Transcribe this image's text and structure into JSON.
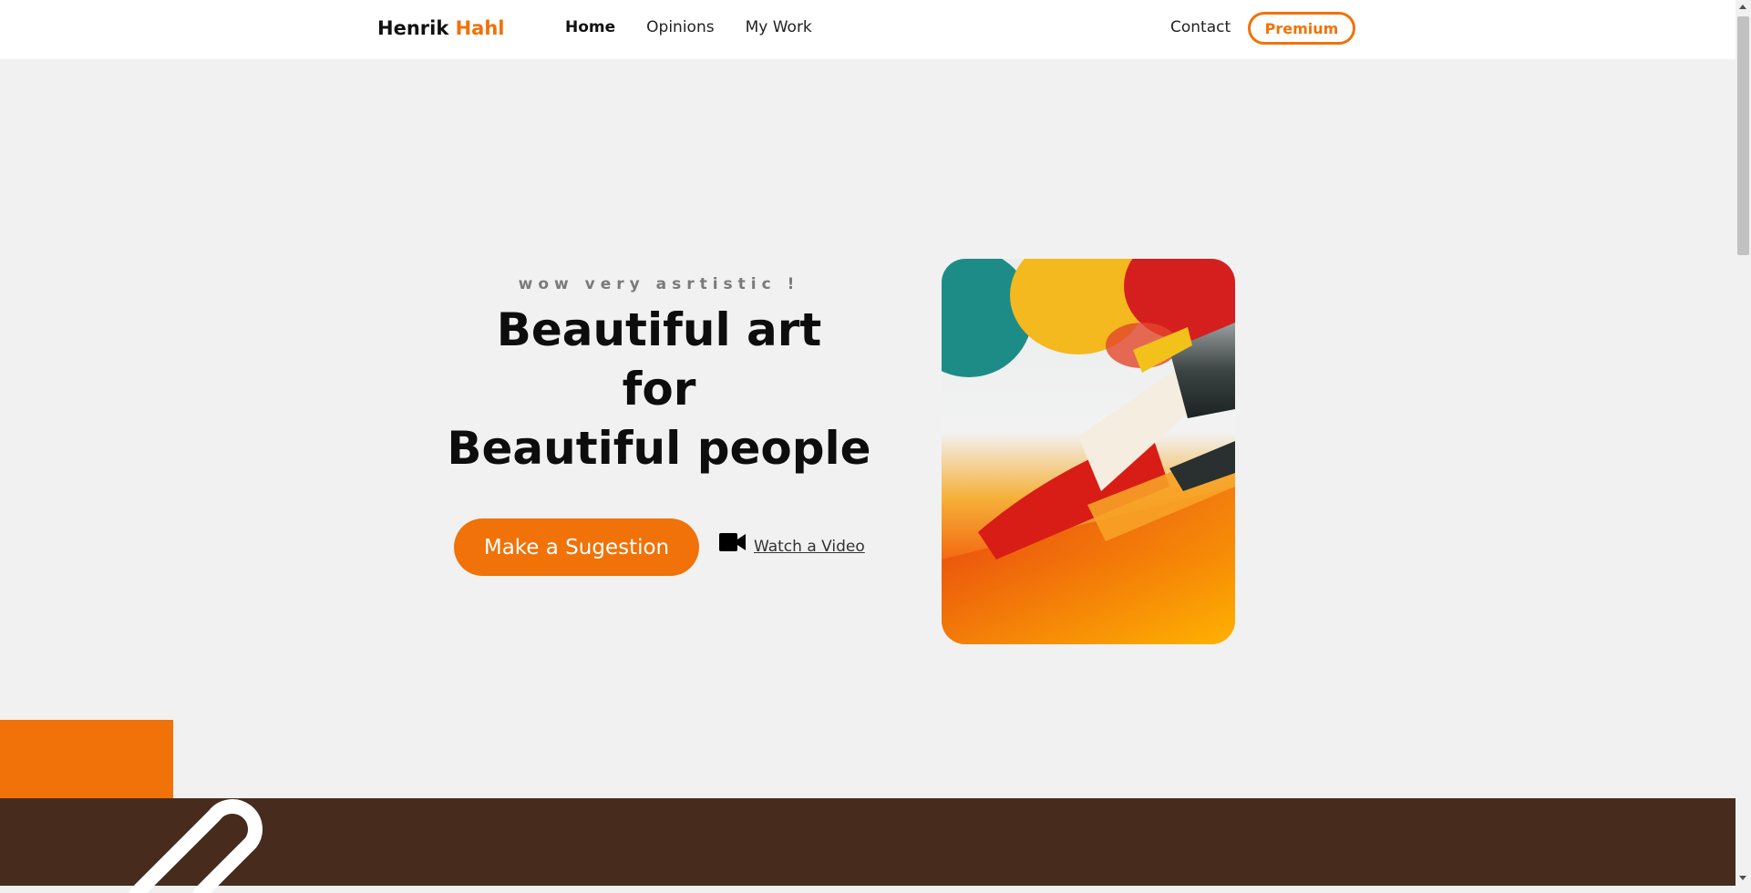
{
  "header": {
    "logo_first": "Henrik",
    "logo_second": "Hahl",
    "nav": [
      "Home",
      "Opinions",
      "My Work"
    ],
    "active_nav": "Home",
    "contact_label": "Contact",
    "premium_label": "Premium"
  },
  "hero": {
    "eyebrow": "wow very asrtistic !",
    "headline_lines": [
      "Beautiful art",
      "for",
      "Beautiful people"
    ],
    "cta_label": "Make a Sugestion",
    "video_link_label": "Watch a Video",
    "video_icon": "video-camera-icon",
    "image_description": "paint-brushes-with-colorful-paint"
  },
  "colors": {
    "accent": "#f07208",
    "band": "#472c1d",
    "background": "#f1f1f1"
  }
}
